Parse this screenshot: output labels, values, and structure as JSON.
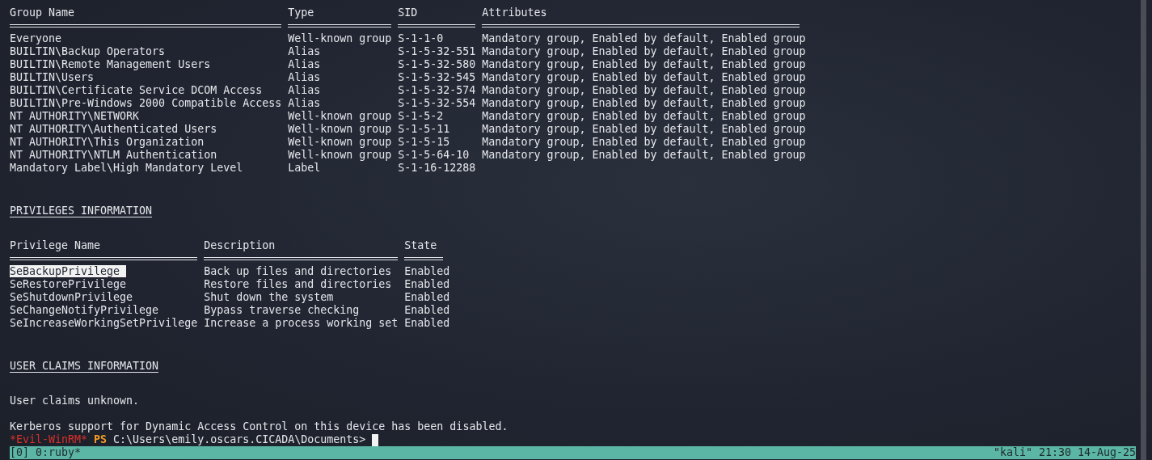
{
  "groups": {
    "columns": [
      "Group Name",
      "Type",
      "SID",
      "Attributes"
    ],
    "rows": [
      {
        "name": "Everyone",
        "type": "Well-known group",
        "sid": "S-1-1-0",
        "attributes": "Mandatory group, Enabled by default, Enabled group"
      },
      {
        "name": "BUILTIN\\Backup Operators",
        "type": "Alias",
        "sid": "S-1-5-32-551",
        "attributes": "Mandatory group, Enabled by default, Enabled group"
      },
      {
        "name": "BUILTIN\\Remote Management Users",
        "type": "Alias",
        "sid": "S-1-5-32-580",
        "attributes": "Mandatory group, Enabled by default, Enabled group"
      },
      {
        "name": "BUILTIN\\Users",
        "type": "Alias",
        "sid": "S-1-5-32-545",
        "attributes": "Mandatory group, Enabled by default, Enabled group"
      },
      {
        "name": "BUILTIN\\Certificate Service DCOM Access",
        "type": "Alias",
        "sid": "S-1-5-32-574",
        "attributes": "Mandatory group, Enabled by default, Enabled group"
      },
      {
        "name": "BUILTIN\\Pre-Windows 2000 Compatible Access",
        "type": "Alias",
        "sid": "S-1-5-32-554",
        "attributes": "Mandatory group, Enabled by default, Enabled group"
      },
      {
        "name": "NT AUTHORITY\\NETWORK",
        "type": "Well-known group",
        "sid": "S-1-5-2",
        "attributes": "Mandatory group, Enabled by default, Enabled group"
      },
      {
        "name": "NT AUTHORITY\\Authenticated Users",
        "type": "Well-known group",
        "sid": "S-1-5-11",
        "attributes": "Mandatory group, Enabled by default, Enabled group"
      },
      {
        "name": "NT AUTHORITY\\This Organization",
        "type": "Well-known group",
        "sid": "S-1-5-15",
        "attributes": "Mandatory group, Enabled by default, Enabled group"
      },
      {
        "name": "NT AUTHORITY\\NTLM Authentication",
        "type": "Well-known group",
        "sid": "S-1-5-64-10",
        "attributes": "Mandatory group, Enabled by default, Enabled group"
      },
      {
        "name": "Mandatory Label\\High Mandatory Level",
        "type": "Label",
        "sid": "S-1-16-12288",
        "attributes": ""
      }
    ]
  },
  "privileges": {
    "heading": "PRIVILEGES INFORMATION",
    "columns": [
      "Privilege Name",
      "Description",
      "State"
    ],
    "rows": [
      {
        "name": "SeBackupPrivilege",
        "description": "Back up files and directories",
        "state": "Enabled",
        "selected": true
      },
      {
        "name": "SeRestorePrivilege",
        "description": "Restore files and directories",
        "state": "Enabled",
        "selected": false
      },
      {
        "name": "SeShutdownPrivilege",
        "description": "Shut down the system",
        "state": "Enabled",
        "selected": false
      },
      {
        "name": "SeChangeNotifyPrivilege",
        "description": "Bypass traverse checking",
        "state": "Enabled",
        "selected": false
      },
      {
        "name": "SeIncreaseWorkingSetPrivilege",
        "description": "Increase a process working set",
        "state": "Enabled",
        "selected": false
      }
    ]
  },
  "user_claims": {
    "heading": "USER CLAIMS INFORMATION",
    "message": "User claims unknown."
  },
  "kerberos_message": "Kerberos support for Dynamic Access Control on this device has been disabled.",
  "prompt": {
    "label": "*Evil-WinRM*",
    "shell": "PS",
    "path": "C:\\Users\\emily.oscars.CICADA\\Documents>"
  },
  "status_bar": {
    "left": "[0] 0:ruby*",
    "right": "\"kali\" 21:30 14-Aug-25"
  }
}
